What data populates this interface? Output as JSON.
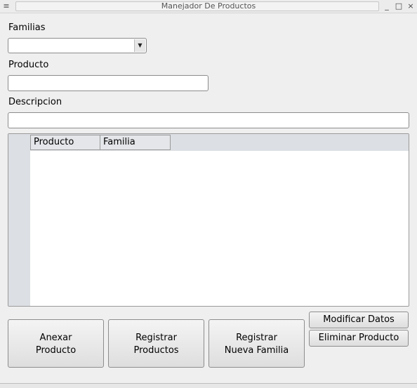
{
  "window": {
    "title": "Manejador De Productos",
    "menu_icon": "≡",
    "minimize_glyph": "_",
    "maximize_glyph": "□",
    "close_glyph": "×"
  },
  "form": {
    "familias_label": "Familias",
    "familias_selected": "",
    "combo_arrow": "▼",
    "producto_label": "Producto",
    "producto_value": "",
    "descripcion_label": "Descripcion",
    "descripcion_value": ""
  },
  "table": {
    "columns": [
      "Producto",
      "Familia"
    ],
    "rows": []
  },
  "buttons": {
    "anexar": [
      "Anexar",
      "Producto"
    ],
    "registrar_productos": [
      "Registrar",
      "Productos"
    ],
    "registrar_familia": [
      "Registrar",
      "Nueva Familia"
    ],
    "modificar": "Modificar Datos",
    "eliminar": "Eliminar Producto"
  }
}
